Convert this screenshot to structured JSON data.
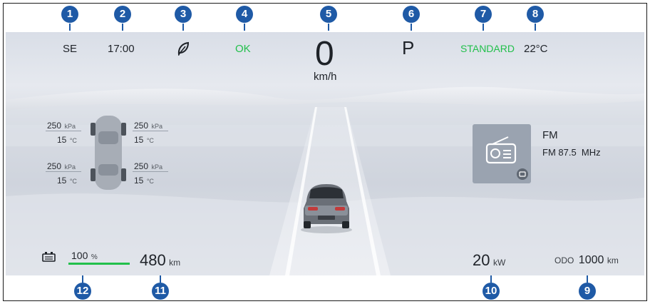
{
  "status_bar": {
    "direction": "SE",
    "time": "17:00",
    "eco_icon": "leaf-icon",
    "system_status": "OK",
    "gear": "P",
    "drive_mode": "STANDARD",
    "temperature": "22°C"
  },
  "speed": {
    "value": "0",
    "unit": "km/h"
  },
  "tires": [
    {
      "pressure": "250",
      "pressure_unit": "kPa",
      "temp": "15",
      "temp_unit": "°C"
    },
    {
      "pressure": "250",
      "pressure_unit": "kPa",
      "temp": "15",
      "temp_unit": "°C"
    },
    {
      "pressure": "250",
      "pressure_unit": "kPa",
      "temp": "15",
      "temp_unit": "°C"
    },
    {
      "pressure": "250",
      "pressure_unit": "kPa",
      "temp": "15",
      "temp_unit": "°C"
    }
  ],
  "media": {
    "source": "FM",
    "station": "FM 87.5  MHz",
    "icon": "radio-icon"
  },
  "battery": {
    "percent": "100",
    "percent_unit": "%",
    "level": 1.0,
    "icon": "battery-icon"
  },
  "range": {
    "value": "480",
    "unit": "km"
  },
  "power": {
    "value": "20",
    "unit": "kW"
  },
  "odometer": {
    "label": "ODO",
    "value": "1000",
    "unit": "km"
  },
  "markers": [
    "1",
    "2",
    "3",
    "4",
    "5",
    "6",
    "7",
    "8",
    "9",
    "10",
    "11",
    "12"
  ],
  "colors": {
    "accent_green": "#22c04b",
    "marker_blue": "#1f5aa6",
    "media_tile": "#9aa3b0"
  }
}
